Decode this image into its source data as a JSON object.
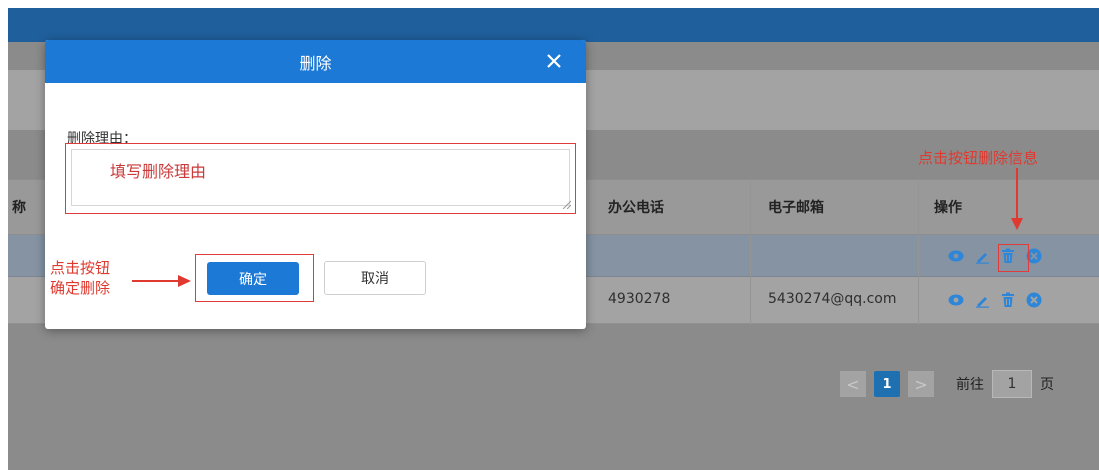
{
  "table": {
    "partial_header": "称",
    "headers": {
      "office_phone": "办公电话",
      "email": "电子邮箱",
      "actions": "操作"
    },
    "rows": [
      {
        "office_phone": "",
        "email": ""
      },
      {
        "office_phone": "4930278",
        "email": "5430274@qq.com"
      }
    ],
    "action_icons": [
      "eye-icon",
      "edit-icon",
      "trash-icon",
      "close-circle-icon"
    ]
  },
  "pagination": {
    "prev": "<",
    "current_page": "1",
    "next": ">",
    "goto_label": "前往",
    "goto_value": "1",
    "page_suffix": "页"
  },
  "modal": {
    "title": "删除",
    "close": "✕",
    "reason_label": "删除理由：",
    "reason_placeholder": "填写删除理由",
    "confirm_button": "确定",
    "cancel_button": "取消"
  },
  "annotations": {
    "delete_hint": "点击按钮删除信息",
    "confirm_hint_line1": "点击按钮",
    "confirm_hint_line2": "确定删除"
  },
  "colors": {
    "header_blue": "#1f5f9c",
    "modal_blue": "#1d79d6",
    "annotation_red": "#e0392f",
    "icon_blue": "#2e86d8"
  }
}
